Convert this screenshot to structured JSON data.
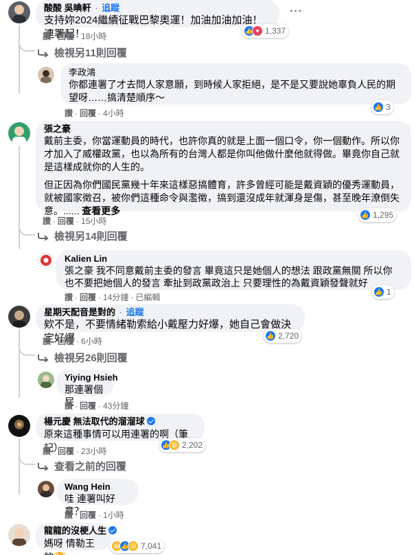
{
  "ui": {
    "like": "讚",
    "reply": "回覆",
    "sep": "·",
    "follow": "追蹤",
    "dots": "···"
  },
  "comments": [
    {
      "name": "酸酸 吳晪軒",
      "text": "支持妳2024繼續征戰巴黎奧運！加油加油加油！連署起！",
      "time": "18小時",
      "reactions": "1,337",
      "more_replies": "檢視另11則回覆"
    },
    {
      "name": "李政鴻",
      "text_1": "你都連署了才去問人家意願，到時候人家拒絕，是不是又要說她辜負人民的期",
      "text_2": "望呀……搞清楚順序～",
      "time": "4小時",
      "reactions": "3"
    },
    {
      "name": "張之豪",
      "para1_1": "戴前主委，你當運動員的時代，也許你真的就是上面一個口令，你一個動作。所以你",
      "para1_2": "才加入了威權政黨，也以為所有的台灣人都是你叫他做什麼他就得做。畢竟你自己就",
      "para1_3": "是這樣成就你的人生的。",
      "para2_1": "但正因為你們國民黨幾十年來這樣惡搞體育，許多曾經可能是戴資穎的優秀運動員，",
      "para2_2": "就被國家徵召，被你們這種命令與濫徵，搞到還沒成年就渾身是傷，甚至晚年潦倒失",
      "para2_3": "意。......",
      "see_more": "查看更多",
      "time": "15小時",
      "reactions": "1,295",
      "more_replies": "檢視另14則回覆"
    },
    {
      "name": "Kalien Lin",
      "tag": "張之豪",
      "text_1": "我不同意戴前主委的發言 畢竟這只是她個人的想法 跟政黨無關 所以你",
      "text_2": "也不要把她個人的發言 牽扯到政黨政治上 只要理性的為戴資穎發聲就好",
      "time": "14分鐘",
      "edited": "已編輯",
      "reactions": "1"
    },
    {
      "name": "星期天配音是對的",
      "text": "欸不是，不要情緒勒索給小戴壓力好爆，她自己會做決定好爆",
      "time": "6小時",
      "reactions": "2,720",
      "more_replies": "檢視另26則回覆"
    },
    {
      "name": "Yiying Hsieh",
      "text": "那連署個屁",
      "time": "43分鐘"
    },
    {
      "name": "楊元慶 無法取代的溜溜球",
      "text": "原來這種事情可以用連署的啊（筆記）",
      "time": "23小時",
      "reactions": "2,202",
      "more_replies": "查看之前的回覆"
    },
    {
      "name": "Wang Hein",
      "text": "哇 連署叫好意？",
      "time": "1小時"
    },
    {
      "name": "龍龍的沒梗人生",
      "text": "媽呀 情勒王欸🏆",
      "reactions": "7,041"
    }
  ],
  "colors": {
    "link": "#1877f2",
    "muted": "#65676b",
    "bubble": "#f0f2f5"
  }
}
